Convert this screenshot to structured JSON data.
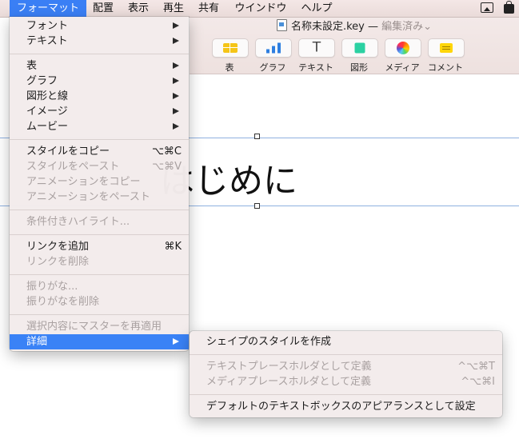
{
  "menubar": {
    "items": [
      "フォーマット",
      "配置",
      "表示",
      "再生",
      "共有",
      "ウインドウ",
      "ヘルプ"
    ],
    "active": "フォーマット",
    "status_icons": [
      "airplay-icon",
      "clipboard-icon"
    ]
  },
  "window": {
    "title": "名称未設定.key",
    "separator": "—",
    "status": "編集済み",
    "status_chevron": "⌄"
  },
  "toolbar": {
    "buttons": [
      {
        "label": "表",
        "icon": "table-icon"
      },
      {
        "label": "グラフ",
        "icon": "chart-icon"
      },
      {
        "label": "テキスト",
        "icon": "text-icon",
        "glyph": "T"
      },
      {
        "label": "図形",
        "icon": "shape-icon"
      },
      {
        "label": "メディア",
        "icon": "media-icon"
      },
      {
        "label": "コメント",
        "icon": "comment-icon"
      }
    ]
  },
  "slide": {
    "title_text": "はじめに"
  },
  "format_menu": {
    "items": [
      {
        "label": "フォント",
        "submenu": true
      },
      {
        "label": "テキスト",
        "submenu": true
      },
      {
        "label": "表",
        "submenu": true
      },
      {
        "label": "グラフ",
        "submenu": true
      },
      {
        "label": "図形と線",
        "submenu": true
      },
      {
        "label": "イメージ",
        "submenu": true
      },
      {
        "label": "ムービー",
        "submenu": true
      },
      {
        "label": "スタイルをコピー",
        "shortcut": "⌥⌘C"
      },
      {
        "label": "スタイルをペースト",
        "shortcut": "⌥⌘V",
        "disabled": true
      },
      {
        "label": "アニメーションをコピー",
        "disabled": true
      },
      {
        "label": "アニメーションをペースト",
        "disabled": true
      },
      {
        "label": "条件付きハイライト...",
        "disabled": true
      },
      {
        "label": "リンクを追加",
        "shortcut": "⌘K"
      },
      {
        "label": "リンクを削除",
        "disabled": true
      },
      {
        "label": "振りがな...",
        "disabled": true
      },
      {
        "label": "振りがなを削除",
        "disabled": true
      },
      {
        "label": "選択内容にマスターを再適用",
        "disabled": true
      },
      {
        "label": "詳細",
        "submenu": true,
        "highlighted": true
      }
    ]
  },
  "advanced_submenu": {
    "items": [
      {
        "label": "シェイプのスタイルを作成"
      },
      {
        "label": "テキストプレースホルダとして定義",
        "shortcut": "^⌥⌘T",
        "disabled": true
      },
      {
        "label": "メディアプレースホルダとして定義",
        "shortcut": "^⌥⌘I",
        "disabled": true
      },
      {
        "label": "デフォルトのテキストボックスのアピアランスとして設定"
      }
    ]
  },
  "colors": {
    "accent": "#3a82f6",
    "menubar": "#eadbd9",
    "disabled_text": "#a9a1a1"
  }
}
